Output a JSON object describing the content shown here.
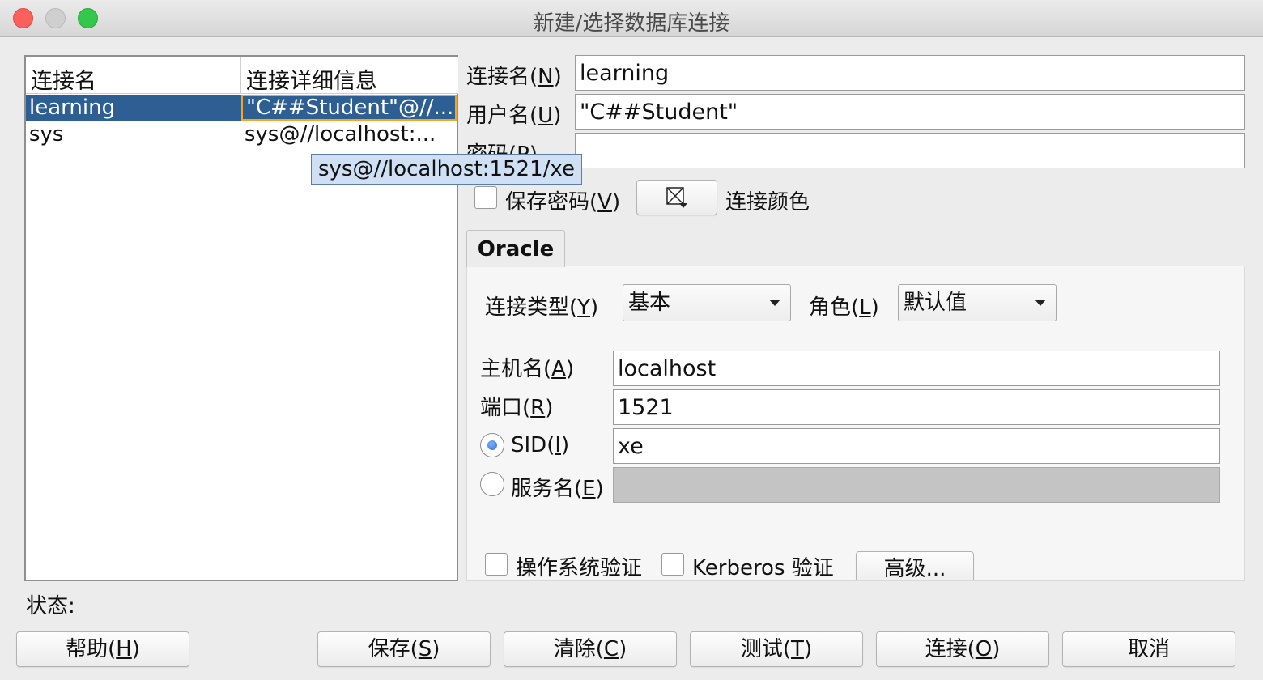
{
  "window": {
    "title": "新建/选择数据库连接"
  },
  "connections": {
    "headers": {
      "name": "连接名",
      "detail": "连接详细信息"
    },
    "rows": [
      {
        "name": "learning",
        "detail": "\"C##Student\"@//..."
      },
      {
        "name": "sys",
        "detail": "sys@//localhost:..."
      }
    ],
    "tooltip": "sys@//localhost:1521/xe"
  },
  "form": {
    "conn_name_label": "连接名(N)",
    "conn_name_value": "learning",
    "user_label": "用户名(U)",
    "user_value": "\"C##Student\"",
    "password_label": "密码(P)",
    "password_value": "",
    "save_password_label": "保存密码(V)",
    "conn_color_label": "连接颜色"
  },
  "oracle": {
    "tab_label": "Oracle",
    "conn_type_label": "连接类型(Y)",
    "conn_type_value": "基本",
    "role_label": "角色(L)",
    "role_value": "默认值",
    "host_label": "主机名(A)",
    "host_value": "localhost",
    "port_label": "端口(R)",
    "port_value": "1521",
    "sid_label": "SID(I)",
    "sid_value": "xe",
    "sid_selected": true,
    "service_label": "服务名(E)",
    "service_value": "",
    "os_auth_label": "操作系统验证",
    "kerberos_label": "Kerberos 验证",
    "advanced_label": "高级..."
  },
  "status": {
    "label": "状态:"
  },
  "buttons": {
    "help": "帮助(H)",
    "save": "保存(S)",
    "clear": "清除(C)",
    "test": "测试(T)",
    "connect": "连接(O)",
    "cancel": "取消"
  },
  "colors": {
    "selection": "#2d5f93",
    "focus": "#f5a623",
    "tooltip_bg": "#cfe0f4"
  }
}
